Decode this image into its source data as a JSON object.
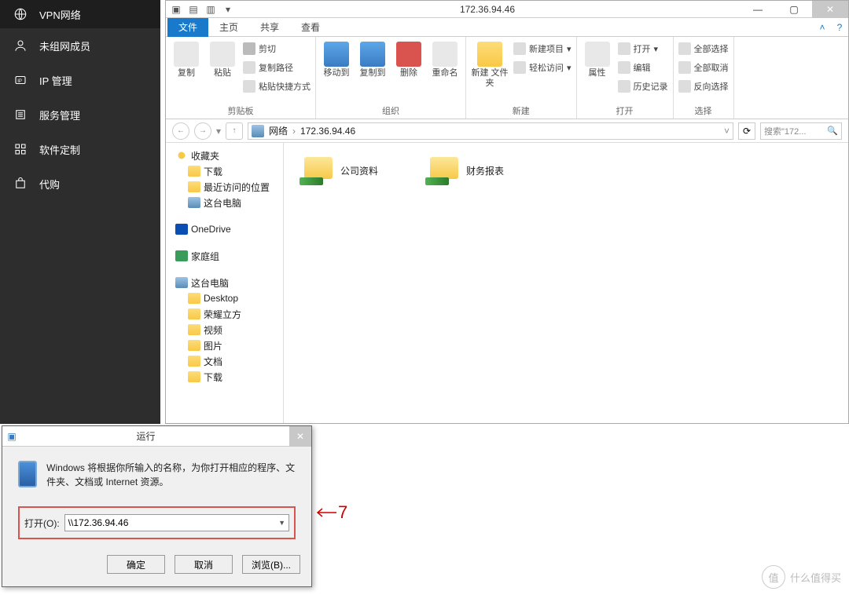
{
  "sidebar": {
    "items": [
      {
        "label": "VPN网络",
        "icon": "vpn-icon"
      },
      {
        "label": "未组网成员",
        "icon": "user-icon"
      },
      {
        "label": "IP 管理",
        "icon": "ip-icon"
      },
      {
        "label": "服务管理",
        "icon": "service-icon"
      },
      {
        "label": "软件定制",
        "icon": "apps-icon"
      },
      {
        "label": "代购",
        "icon": "cart-icon"
      }
    ]
  },
  "explorer": {
    "title": "172.36.94.46",
    "tabs": {
      "file": "文件",
      "home": "主页",
      "share": "共享",
      "view": "查看"
    },
    "ribbon": {
      "clipboard": {
        "label": "剪贴板",
        "copy": "复制",
        "paste": "粘贴",
        "cut": "剪切",
        "copypath": "复制路径",
        "pasteshortcut": "粘贴快捷方式"
      },
      "organize": {
        "label": "组织",
        "moveto": "移动到",
        "copyto": "复制到",
        "delete": "删除",
        "rename": "重命名"
      },
      "new": {
        "label": "新建",
        "newfolder": "新建\n文件夹",
        "newitem": "新建项目",
        "easyaccess": "轻松访问"
      },
      "open": {
        "label": "打开",
        "properties": "属性",
        "openbtn": "打开",
        "edit": "编辑",
        "history": "历史记录"
      },
      "select": {
        "label": "选择",
        "selectall": "全部选择",
        "selectnone": "全部取消",
        "invert": "反向选择"
      }
    },
    "address": {
      "network": "网络",
      "target": "172.36.94.46"
    },
    "search_placeholder": "搜索\"172...",
    "tree": {
      "favorites": "收藏夹",
      "downloads": "下载",
      "recent": "最近访问的位置",
      "thispc_fav": "这台电脑",
      "onedrive": "OneDrive",
      "homegroup": "家庭组",
      "thispc": "这台电脑",
      "desktop": "Desktop",
      "honor": "荣耀立方",
      "videos": "视频",
      "pictures": "图片",
      "documents": "文档",
      "downloads2": "下载"
    },
    "files": [
      {
        "name": "公司资料"
      },
      {
        "name": "财务报表"
      }
    ]
  },
  "run": {
    "title": "运行",
    "message": "Windows 将根据你所输入的名称，为你打开相应的程序、文件夹、文档或 Internet 资源。",
    "open_label": "打开(O):",
    "value": "\\\\172.36.94.46",
    "ok": "确定",
    "cancel": "取消",
    "browse": "浏览(B)..."
  },
  "annotation": {
    "num": "7"
  },
  "watermark": {
    "badge": "值",
    "text": "什么值得买"
  }
}
